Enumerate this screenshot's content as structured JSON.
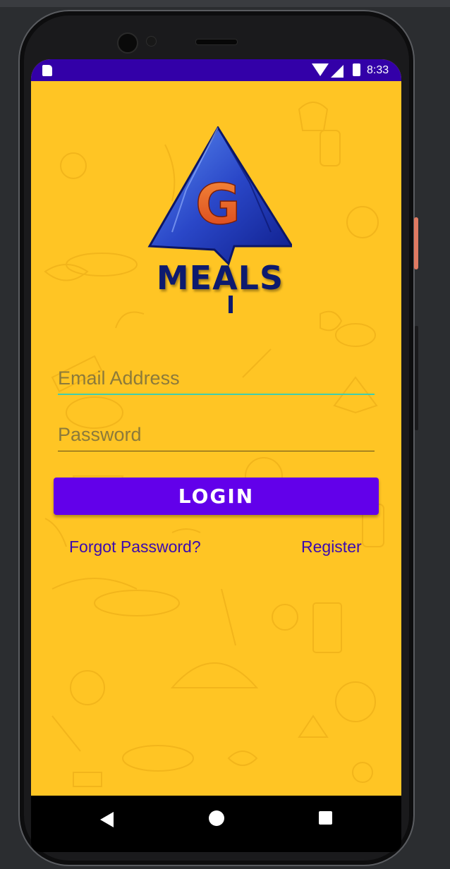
{
  "status_bar": {
    "time": "8:33",
    "background": "#3300a8",
    "icons": [
      "sim-icon",
      "wifi-icon",
      "signal-icon",
      "battery-icon"
    ]
  },
  "app": {
    "logo_letter": "G",
    "logo_title": "MEALS",
    "background": "#ffc524"
  },
  "form": {
    "email_placeholder": "Email Address",
    "email_value": "",
    "password_placeholder": "Password",
    "password_value": "",
    "login_label": "LOGIN",
    "forgot_label": "Forgot Password?",
    "register_label": "Register",
    "accent": "#6200ea",
    "focus_line": "#3fcfae"
  },
  "nav_bar": {
    "icons": [
      "back-icon",
      "home-icon",
      "recents-icon"
    ]
  }
}
